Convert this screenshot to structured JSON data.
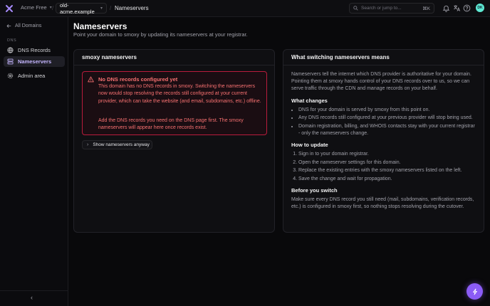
{
  "topbar": {
    "team_name": "Acme Free",
    "domain": "old-acme.example",
    "breadcrumb_current": "Nameservers",
    "search_placeholder": "Search or jump to...",
    "search_shortcut": "⌘K",
    "avatar_initials": "DK"
  },
  "sidebar": {
    "back_label": "All Domains",
    "section_label": "DNS",
    "items": [
      {
        "label": "DNS Records",
        "icon": "dns-records-icon"
      },
      {
        "label": "Nameservers",
        "icon": "nameservers-icon",
        "active": true
      },
      {
        "label": "Admin area",
        "icon": "admin-icon"
      }
    ]
  },
  "page": {
    "title": "Nameservers",
    "subtitle": "Point your domain to smoxy by updating its nameservers at your registrar."
  },
  "left_card": {
    "title": "smoxy nameservers",
    "alert": {
      "title": "No DNS records configured yet",
      "p1": "This domain has no DNS records in smoxy. Switching the nameservers now would stop resolving the records still configured at your current provider, which can take the website (and email, subdomains, etc.) offline.",
      "p2": "Add the DNS records you need on the DNS page first. The smoxy nameservers will appear here once records exist."
    },
    "show_button": "Show nameservers anyway"
  },
  "right_card": {
    "title": "What switching nameservers means",
    "intro": "Nameservers tell the internet which DNS provider is authoritative for your domain. Pointing them at smoxy hands control of your DNS records over to us, so we can serve traffic through the CDN and manage records on your behalf.",
    "what_changes_heading": "What changes",
    "what_changes": [
      "DNS for your domain is served by smoxy from this point on.",
      "Any DNS records still configured at your previous provider will stop being used.",
      "Domain registration, billing, and WHOIS contacts stay with your current registrar - only the nameservers change."
    ],
    "how_heading": "How to update",
    "how_steps": [
      "Sign in to your domain registrar.",
      "Open the nameserver settings for this domain.",
      "Replace the existing entries with the smoxy nameservers listed on the left.",
      "Save the change and wait for propagation."
    ],
    "before_heading": "Before you switch",
    "before_text": "Make sure every DNS record you still need (mail, subdomains, verification records, etc.) is configured in smoxy first, so nothing stops resolving during the cutover."
  },
  "colors": {
    "accent": "#8b5cf6",
    "alert": "#f87171",
    "alert_border": "#b91c3c",
    "background": "#09090b"
  }
}
